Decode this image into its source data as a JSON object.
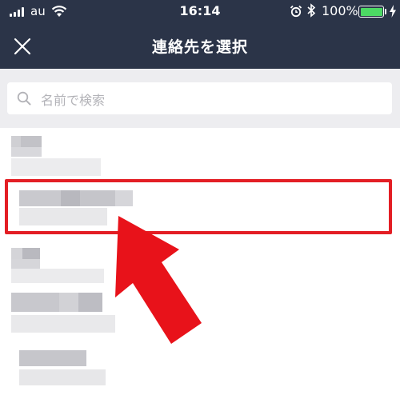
{
  "status_bar": {
    "carrier": "au",
    "time": "16:14",
    "battery_percent": "100%",
    "battery_level": 1.0,
    "signal_bars": 4,
    "icons": [
      "signal-icon",
      "wifi-icon",
      "alarm-icon",
      "bluetooth-icon",
      "battery-icon",
      "charging-icon"
    ]
  },
  "nav": {
    "title": "連絡先を選択",
    "close_icon": "close-icon"
  },
  "search": {
    "placeholder": "名前で検索",
    "icon": "search-icon"
  },
  "contacts": {
    "count": 5,
    "names_blurred": true,
    "selected_index": 1
  },
  "annotation": {
    "highlight_color": "#e31e24",
    "arrow_color": "#e8121a"
  },
  "colors": {
    "header_bg": "#2b3448",
    "search_bg": "#ededf0",
    "battery_fill": "#4cd964"
  }
}
